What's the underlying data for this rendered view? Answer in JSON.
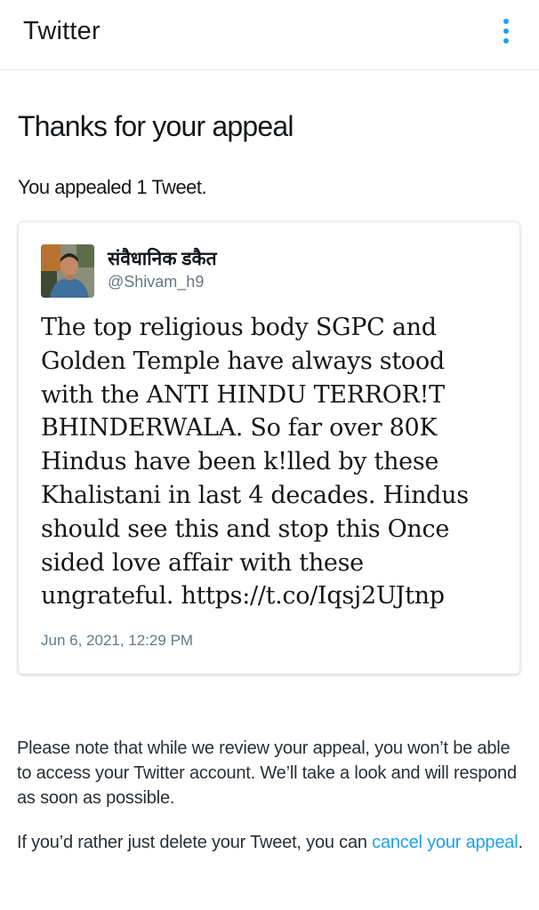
{
  "app": {
    "title": "Twitter"
  },
  "header": {
    "menu_icon": "more-vertical-icon",
    "accent_color": "#1da1f2"
  },
  "main": {
    "heading": "Thanks for your appeal",
    "subheading": "You appealed 1 Tweet."
  },
  "tweet": {
    "author_name": "संवैधानिक डकैत",
    "author_handle": "@Shivam_h9",
    "text_lines": [
      "The top religious body SGPC and",
      "Golden Temple have always stood",
      "with the ANTI HINDU TERROR!T",
      "BHINDERWALA. So far over 80K",
      "Hindus have been k!lled by these",
      "Khalistani in last 4 decades. Hindus",
      "should see this and stop this Once",
      "sided love affair with these",
      "ungrateful. https://t.co/Iqsj2UJtnp"
    ],
    "timestamp": "Jun 6, 2021, 12:29 PM"
  },
  "footer": {
    "note": "Please note that while we review your appeal, you won’t be able to access your Twitter account. We’ll take a look and will respond as soon as possible.",
    "delete_prefix": "If you’d rather just delete your Tweet, you can ",
    "cancel_link": "cancel your appeal",
    "delete_suffix": "."
  }
}
